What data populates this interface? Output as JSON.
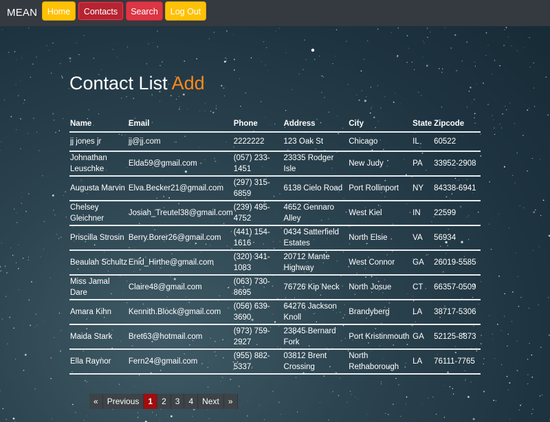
{
  "nav": {
    "brand": "MEAN",
    "items": [
      {
        "label": "Home",
        "style": "yellow"
      },
      {
        "label": "Contacts",
        "style": "active"
      },
      {
        "label": "Search",
        "style": "red"
      },
      {
        "label": "Log Out",
        "style": "yellow"
      }
    ]
  },
  "page": {
    "title": "Contact List",
    "add_label": "Add"
  },
  "table": {
    "headers": [
      "Name",
      "Email",
      "Phone",
      "Address",
      "City",
      "State",
      "Zipcode"
    ],
    "rows": [
      [
        "jj jones jr",
        "jj@jj.com",
        "2222222",
        "123 Oak St",
        "Chicago",
        "IL",
        "60522"
      ],
      [
        "Johnathan Leuschke",
        "Elda59@gmail.com",
        "(057) 233-1451",
        "23335 Rodger Isle",
        "New Judy",
        "PA",
        "33952-2908"
      ],
      [
        "Augusta Marvin",
        "Elva.Becker21@gmail.com",
        "(297) 315-6859",
        "6138 Cielo Road",
        "Port Rollinport",
        "NY",
        "84338-6941"
      ],
      [
        "Chelsey Gleichner",
        "Josiah_Treutel38@gmail.com",
        "(239) 495-4752",
        "4652 Gennaro Alley",
        "West Kiel",
        "IN",
        "22599"
      ],
      [
        "Priscilla Strosin",
        "Berry.Borer26@gmail.com",
        "(441) 154-1616",
        "0434 Satterfield Estates",
        "North Elsie",
        "VA",
        "56934"
      ],
      [
        "Beaulah Schultz",
        "Enid_Hirthe@gmail.com",
        "(320) 341-1083",
        "20712 Mante Highway",
        "West Connor",
        "GA",
        "26019-5585"
      ],
      [
        "Miss Jamal Dare",
        "Claire48@gmail.com",
        "(063) 730-8695",
        "76726 Kip Neck",
        "North Josue",
        "CT",
        "66357-0509"
      ],
      [
        "Amara Kihn",
        "Kennith.Block@gmail.com",
        "(056) 639-3690",
        "64276 Jackson Knoll",
        "Brandyberg",
        "LA",
        "38717-5306"
      ],
      [
        "Maida Stark",
        "Bret63@hotmail.com",
        "(973) 759-2927",
        "23845 Bernard Fork",
        "Port Kristinmouth",
        "GA",
        "52125-8873"
      ],
      [
        "Ella Raynor",
        "Fern24@gmail.com",
        "(955) 882-5337",
        "03812 Brent Crossing",
        "North Rethaborough",
        "LA",
        "76111-7765"
      ]
    ]
  },
  "pagination": {
    "first": "«",
    "previous": "Previous",
    "pages": [
      "1",
      "2",
      "3",
      "4"
    ],
    "current": "1",
    "next": "Next",
    "last": "»"
  },
  "colors": {
    "navbar": "#343a40",
    "yellow_button": "#ffc107",
    "red_button": "#dc3545",
    "active_button": "#b52432",
    "add_link": "#fd8a1a",
    "current_page": "#a00d0d"
  }
}
